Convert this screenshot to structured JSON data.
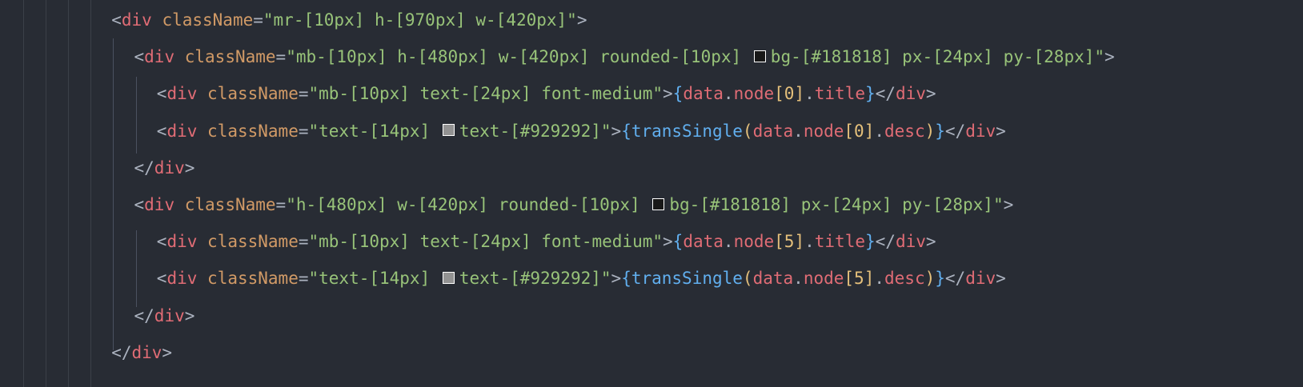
{
  "lines": [
    {
      "indent": 4,
      "tokens": [
        {
          "t": "<",
          "c": "punc"
        },
        {
          "t": "div",
          "c": "tag"
        },
        {
          "t": " ",
          "c": "punc"
        },
        {
          "t": "className",
          "c": "attr"
        },
        {
          "t": "=",
          "c": "punc"
        },
        {
          "t": "\"mr-[10px] h-[970px] w-[420px]\"",
          "c": "str"
        },
        {
          "t": ">",
          "c": "punc"
        }
      ]
    },
    {
      "indent": 5,
      "tokens": [
        {
          "t": "<",
          "c": "punc"
        },
        {
          "t": "div",
          "c": "tag"
        },
        {
          "t": " ",
          "c": "punc"
        },
        {
          "t": "className",
          "c": "attr"
        },
        {
          "t": "=",
          "c": "punc"
        },
        {
          "t": "\"mb-[10px] h-[480px] w-[420px] rounded-[10px] ",
          "c": "str"
        },
        {
          "swatch": "#181818"
        },
        {
          "t": "bg-[#181818] px-[24px] py-[28px]\"",
          "c": "str"
        },
        {
          "t": ">",
          "c": "punc"
        }
      ]
    },
    {
      "indent": 6,
      "tokens": [
        {
          "t": "<",
          "c": "punc"
        },
        {
          "t": "div",
          "c": "tag"
        },
        {
          "t": " ",
          "c": "punc"
        },
        {
          "t": "className",
          "c": "attr"
        },
        {
          "t": "=",
          "c": "punc"
        },
        {
          "t": "\"mb-[10px] text-[24px] font-medium\"",
          "c": "str"
        },
        {
          "t": ">",
          "c": "punc"
        },
        {
          "t": "{",
          "c": "brace"
        },
        {
          "t": "data",
          "c": "var"
        },
        {
          "t": ".",
          "c": "punc"
        },
        {
          "t": "node",
          "c": "var"
        },
        {
          "t": "[",
          "c": "num"
        },
        {
          "t": "0",
          "c": "num"
        },
        {
          "t": "]",
          "c": "num"
        },
        {
          "t": ".",
          "c": "punc"
        },
        {
          "t": "title",
          "c": "var"
        },
        {
          "t": "}",
          "c": "brace"
        },
        {
          "t": "</",
          "c": "punc"
        },
        {
          "t": "div",
          "c": "tag"
        },
        {
          "t": ">",
          "c": "punc"
        }
      ]
    },
    {
      "indent": 6,
      "tokens": [
        {
          "t": "<",
          "c": "punc"
        },
        {
          "t": "div",
          "c": "tag"
        },
        {
          "t": " ",
          "c": "punc"
        },
        {
          "t": "className",
          "c": "attr"
        },
        {
          "t": "=",
          "c": "punc"
        },
        {
          "t": "\"text-[14px] ",
          "c": "str"
        },
        {
          "swatch": "#929292"
        },
        {
          "t": "text-[#929292]\"",
          "c": "str"
        },
        {
          "t": ">",
          "c": "punc"
        },
        {
          "t": "{",
          "c": "brace"
        },
        {
          "t": "transSingle",
          "c": "fn"
        },
        {
          "t": "(",
          "c": "paren"
        },
        {
          "t": "data",
          "c": "var"
        },
        {
          "t": ".",
          "c": "punc"
        },
        {
          "t": "node",
          "c": "var"
        },
        {
          "t": "[",
          "c": "num"
        },
        {
          "t": "0",
          "c": "num"
        },
        {
          "t": "]",
          "c": "num"
        },
        {
          "t": ".",
          "c": "punc"
        },
        {
          "t": "desc",
          "c": "var"
        },
        {
          "t": ")",
          "c": "paren"
        },
        {
          "t": "}",
          "c": "brace"
        },
        {
          "t": "</",
          "c": "punc"
        },
        {
          "t": "div",
          "c": "tag"
        },
        {
          "t": ">",
          "c": "punc"
        }
      ]
    },
    {
      "indent": 5,
      "tokens": [
        {
          "t": "</",
          "c": "punc"
        },
        {
          "t": "div",
          "c": "tag"
        },
        {
          "t": ">",
          "c": "punc"
        }
      ]
    },
    {
      "indent": 5,
      "tokens": [
        {
          "t": "<",
          "c": "punc"
        },
        {
          "t": "div",
          "c": "tag"
        },
        {
          "t": " ",
          "c": "punc"
        },
        {
          "t": "className",
          "c": "attr"
        },
        {
          "t": "=",
          "c": "punc"
        },
        {
          "t": "\"h-[480px] w-[420px] rounded-[10px] ",
          "c": "str"
        },
        {
          "swatch": "#181818"
        },
        {
          "t": "bg-[#181818] px-[24px] py-[28px]\"",
          "c": "str"
        },
        {
          "t": ">",
          "c": "punc"
        }
      ]
    },
    {
      "indent": 6,
      "tokens": [
        {
          "t": "<",
          "c": "punc"
        },
        {
          "t": "div",
          "c": "tag"
        },
        {
          "t": " ",
          "c": "punc"
        },
        {
          "t": "className",
          "c": "attr"
        },
        {
          "t": "=",
          "c": "punc"
        },
        {
          "t": "\"mb-[10px] text-[24px] font-medium\"",
          "c": "str"
        },
        {
          "t": ">",
          "c": "punc"
        },
        {
          "t": "{",
          "c": "brace"
        },
        {
          "t": "data",
          "c": "var"
        },
        {
          "t": ".",
          "c": "punc"
        },
        {
          "t": "node",
          "c": "var"
        },
        {
          "t": "[",
          "c": "num"
        },
        {
          "t": "5",
          "c": "num"
        },
        {
          "t": "]",
          "c": "num"
        },
        {
          "t": ".",
          "c": "punc"
        },
        {
          "t": "title",
          "c": "var"
        },
        {
          "t": "}",
          "c": "brace"
        },
        {
          "t": "</",
          "c": "punc"
        },
        {
          "t": "div",
          "c": "tag"
        },
        {
          "t": ">",
          "c": "punc"
        }
      ]
    },
    {
      "indent": 6,
      "tokens": [
        {
          "t": "<",
          "c": "punc"
        },
        {
          "t": "div",
          "c": "tag"
        },
        {
          "t": " ",
          "c": "punc"
        },
        {
          "t": "className",
          "c": "attr"
        },
        {
          "t": "=",
          "c": "punc"
        },
        {
          "t": "\"text-[14px] ",
          "c": "str"
        },
        {
          "swatch": "#929292"
        },
        {
          "t": "text-[#929292]\"",
          "c": "str"
        },
        {
          "t": ">",
          "c": "punc"
        },
        {
          "t": "{",
          "c": "brace"
        },
        {
          "t": "transSingle",
          "c": "fn"
        },
        {
          "t": "(",
          "c": "paren"
        },
        {
          "t": "data",
          "c": "var"
        },
        {
          "t": ".",
          "c": "punc"
        },
        {
          "t": "node",
          "c": "var"
        },
        {
          "t": "[",
          "c": "num"
        },
        {
          "t": "5",
          "c": "num"
        },
        {
          "t": "]",
          "c": "num"
        },
        {
          "t": ".",
          "c": "punc"
        },
        {
          "t": "desc",
          "c": "var"
        },
        {
          "t": ")",
          "c": "paren"
        },
        {
          "t": "}",
          "c": "brace"
        },
        {
          "t": "</",
          "c": "punc"
        },
        {
          "t": "div",
          "c": "tag"
        },
        {
          "t": ">",
          "c": "punc"
        }
      ]
    },
    {
      "indent": 5,
      "tokens": [
        {
          "t": "</",
          "c": "punc"
        },
        {
          "t": "div",
          "c": "tag"
        },
        {
          "t": ">",
          "c": "punc"
        }
      ]
    },
    {
      "indent": 4,
      "tokens": [
        {
          "t": "</",
          "c": "punc"
        },
        {
          "t": "div",
          "c": "tag"
        },
        {
          "t": ">",
          "c": "punc"
        }
      ]
    }
  ],
  "colors": {
    "background": "#282c34",
    "tag": "#e06c75",
    "attribute": "#d19a66",
    "string": "#98c379",
    "brace": "#61afef",
    "number": "#e5c07b"
  }
}
